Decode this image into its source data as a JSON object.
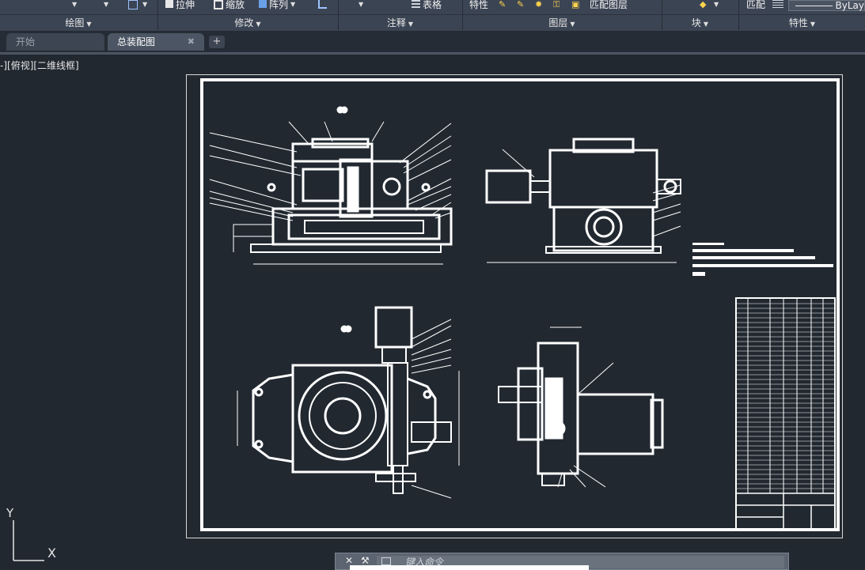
{
  "ribbon": {
    "top_tools": {
      "stretch": "拉伸",
      "scale": "缩放",
      "array": "阵列",
      "table": "表格",
      "properties": "特性",
      "match_layer": "匹配图层",
      "match": "匹配",
      "bylayer": "ByLay"
    },
    "panels": {
      "draw": "绘图",
      "modify": "修改",
      "annotate": "注释",
      "layers": "图层",
      "block": "块",
      "properties": "特性"
    }
  },
  "tabs": {
    "start": "开始",
    "drawing": "总装配图",
    "close_glyph": "✖",
    "add_glyph": "+"
  },
  "viewport": {
    "label": "-][俯视][二维线框]"
  },
  "ucs": {
    "y": "Y",
    "x": "X"
  },
  "command": {
    "placeholder": "键入命令",
    "close_glyph": "✕"
  },
  "colors": {
    "background": "#212830",
    "ribbon": "#3b4453",
    "drawing_lines": "#ffffff"
  }
}
